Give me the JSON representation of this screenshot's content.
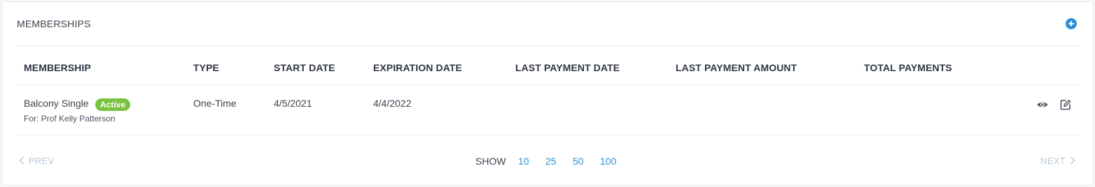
{
  "section": {
    "title": "MEMBERSHIPS",
    "add_icon": "plus-circle-icon",
    "accent_color": "#2d8fd5"
  },
  "table": {
    "columns": [
      "MEMBERSHIP",
      "TYPE",
      "START DATE",
      "EXPIRATION DATE",
      "LAST PAYMENT DATE",
      "LAST PAYMENT AMOUNT",
      "TOTAL PAYMENTS"
    ],
    "rows": [
      {
        "membership": "Balcony Single",
        "status": "Active",
        "status_color": "#7ac142",
        "for": "For: Prof Kelly Patterson",
        "type": "One-Time",
        "start_date": "4/5/2021",
        "expiration_date": "4/4/2022",
        "last_payment_date": "",
        "last_payment_amount": "",
        "total_payments": "",
        "actions": [
          "eye-icon",
          "edit-icon"
        ]
      }
    ]
  },
  "pagination": {
    "prev_label": "PREV",
    "next_label": "NEXT",
    "show_label": "SHOW",
    "page_sizes": [
      "10",
      "25",
      "50",
      "100"
    ]
  }
}
